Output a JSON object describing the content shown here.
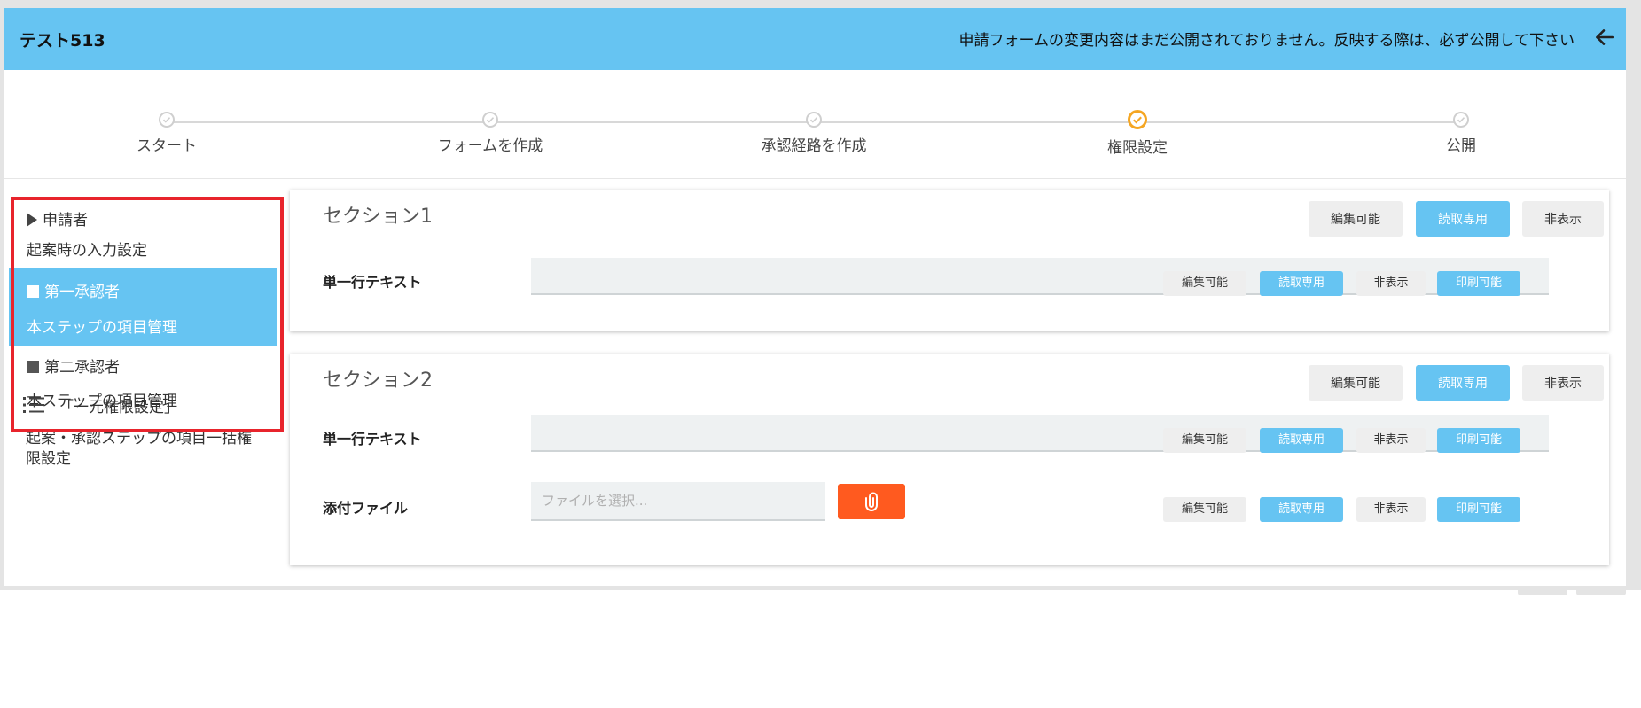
{
  "header": {
    "title": "テスト513",
    "notice": "申請フォームの変更内容はまだ公開されておりません。反映する際は、必ず公開して下さい",
    "back_icon": "arrow-left-icon"
  },
  "stepper": {
    "steps": [
      {
        "label": "スタート",
        "state": "done"
      },
      {
        "label": "フォームを作成",
        "state": "done"
      },
      {
        "label": "承認経路を作成",
        "state": "done"
      },
      {
        "label": "権限設定",
        "state": "active"
      },
      {
        "label": "公開",
        "state": "done"
      }
    ],
    "active_color": "#f5a623"
  },
  "sidebar": {
    "groups": [
      {
        "title": "申請者",
        "subtitle": "起案時の入力設定",
        "marker": "triangle-right-icon",
        "active": false
      },
      {
        "title": "第一承認者",
        "subtitle": "本ステップの項目管理",
        "marker": "square-icon",
        "active": true
      },
      {
        "title": "第二承認者",
        "subtitle": "本ステップの項目管理",
        "marker": "square-icon",
        "active": false
      }
    ],
    "bulk": {
      "label": "「一元権限設定」",
      "icon": "list-icon",
      "description": "起案・承認ステップの項目一括権限設定"
    },
    "highlight_color": "#e8242c"
  },
  "sections": [
    {
      "title": "セクション1",
      "buttons": {
        "editable": "編集可能",
        "readonly": "読取専用",
        "hidden": "非表示"
      },
      "fields": [
        {
          "label": "単一行テキスト",
          "type": "text",
          "buttons": {
            "editable": "編集可能",
            "readonly": "読取専用",
            "hidden": "非表示",
            "printable": "印刷可能"
          }
        }
      ]
    },
    {
      "title": "セクション2",
      "buttons": {
        "editable": "編集可能",
        "readonly": "読取専用",
        "hidden": "非表示"
      },
      "fields": [
        {
          "label": "単一行テキスト",
          "type": "text",
          "buttons": {
            "editable": "編集可能",
            "readonly": "読取専用",
            "hidden": "非表示",
            "printable": "印刷可能"
          }
        },
        {
          "label": "添付ファイル",
          "type": "file",
          "placeholder": "ファイルを選択...",
          "attach_icon": "paperclip-icon",
          "buttons": {
            "editable": "編集可能",
            "readonly": "読取専用",
            "hidden": "非表示",
            "printable": "印刷可能"
          }
        }
      ]
    }
  ],
  "colors": {
    "header_bg": "#66c4f2",
    "accent_blue": "#66c4f2",
    "attach_orange": "#ff5a1f"
  }
}
